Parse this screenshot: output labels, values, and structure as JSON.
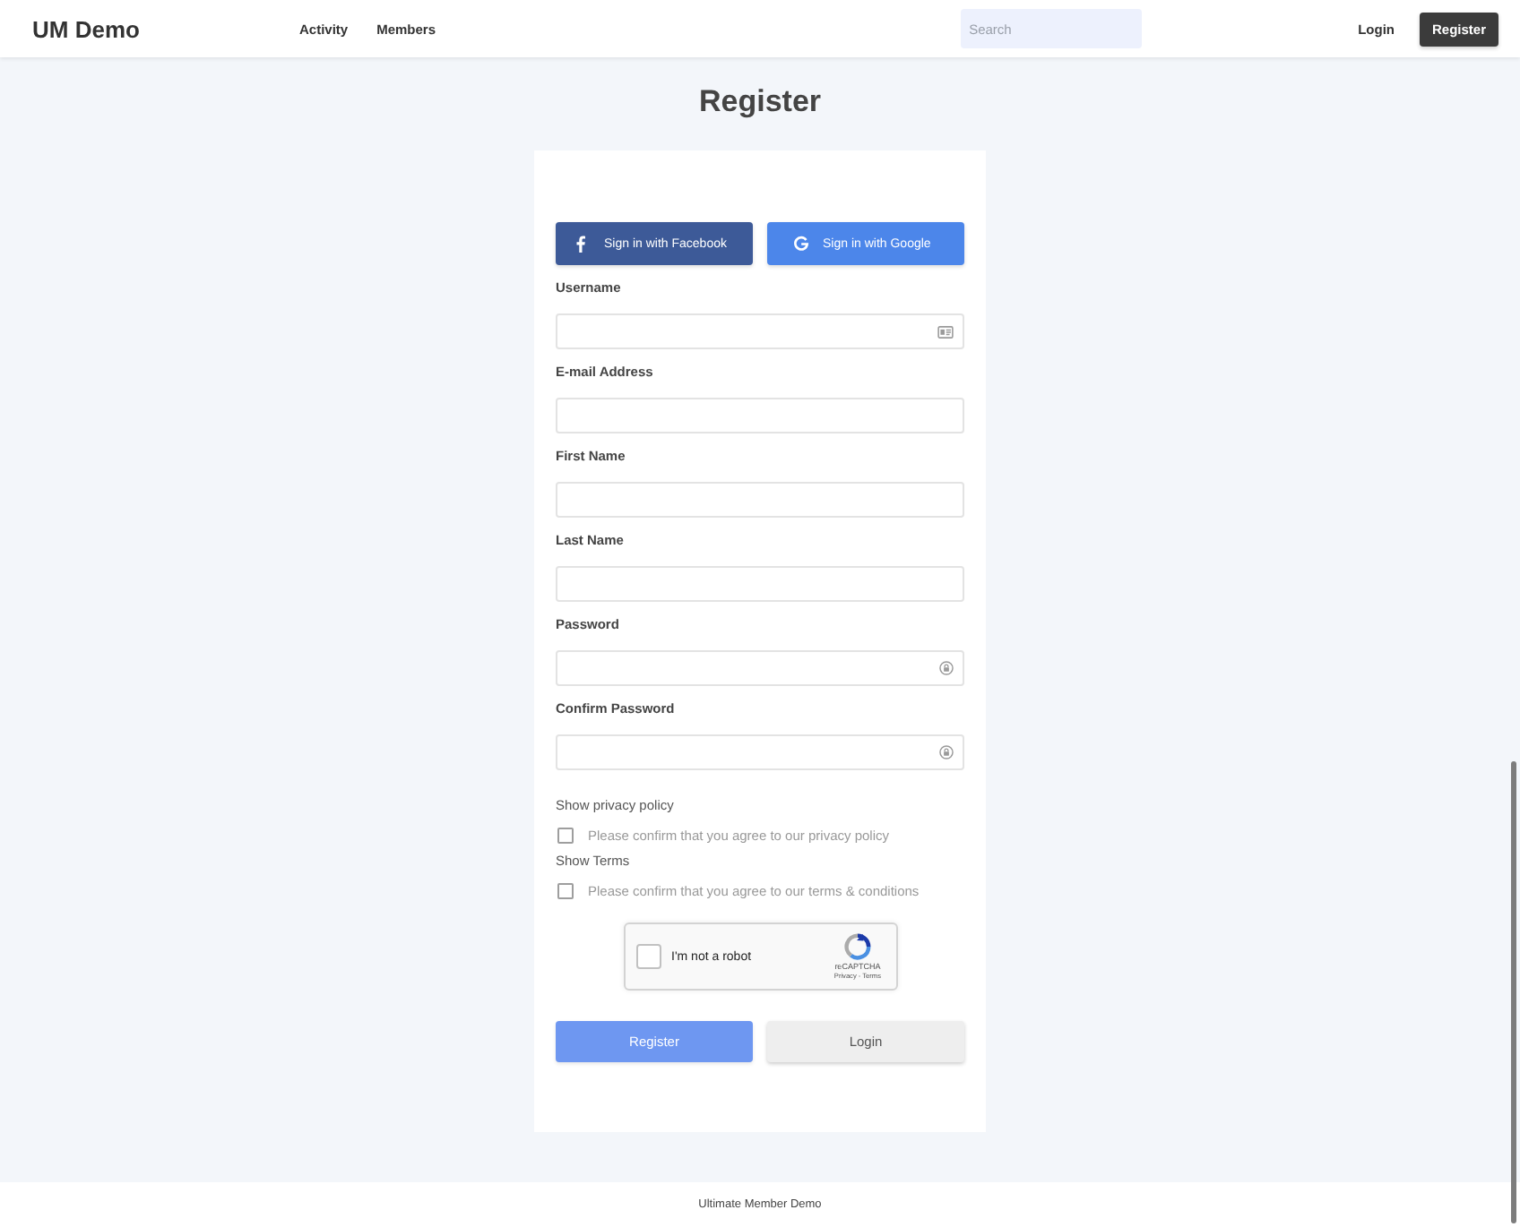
{
  "header": {
    "logo": "UM Demo",
    "nav": [
      {
        "label": "Activity"
      },
      {
        "label": "Members"
      }
    ],
    "search": {
      "placeholder": "Search"
    },
    "login": "Login",
    "register": "Register"
  },
  "page_title": "Register",
  "social_buttons": [
    {
      "kind": "facebook",
      "label": "Sign in with Facebook"
    },
    {
      "kind": "google",
      "label": "Sign in with Google"
    }
  ],
  "fields": [
    {
      "label": "Username",
      "kind": "username"
    },
    {
      "label": "E-mail Address",
      "kind": "text"
    },
    {
      "label": "First Name",
      "kind": "text"
    },
    {
      "label": "Last Name",
      "kind": "text"
    },
    {
      "label": "Password",
      "kind": "password"
    },
    {
      "label": "Confirm Password",
      "kind": "password"
    }
  ],
  "consents": [
    {
      "heading": "Show privacy policy",
      "label": "Please confirm that you agree to our privacy policy",
      "checked": false
    },
    {
      "heading": "Show Terms",
      "label": "Please confirm that you agree to our terms & conditions",
      "checked": false
    }
  ],
  "captcha": {
    "label": "I'm not a robot",
    "checked": false,
    "brand": "reCAPTCHA",
    "links": "Privacy - Terms"
  },
  "actions": [
    {
      "kind": "primary",
      "label": "Register"
    },
    {
      "kind": "secondary",
      "label": "Login"
    }
  ],
  "footer": "Ultimate Member Demo"
}
